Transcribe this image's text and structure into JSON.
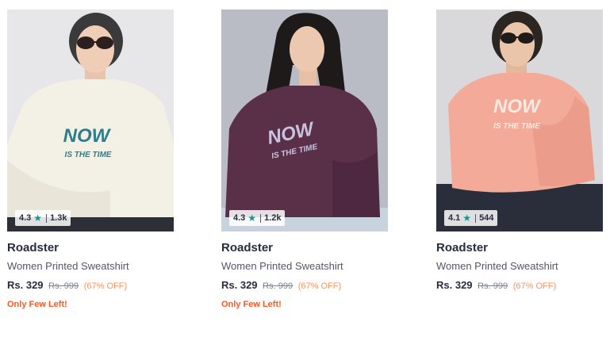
{
  "products": [
    {
      "brand": "Roadster",
      "name": "Women Printed Sweatshirt",
      "price": "Rs. 329",
      "mrp": "Rs. 999",
      "discount": "(67% OFF)",
      "rating": "4.3",
      "rating_count": "1.3k",
      "stock_note": "Only Few Left!",
      "print_line1": "NOW",
      "print_line2": "IS THE TIME",
      "sweatshirt_color": "#f3f0e6",
      "print_color": "#2f7d8a"
    },
    {
      "brand": "Roadster",
      "name": "Women Printed Sweatshirt",
      "price": "Rs. 329",
      "mrp": "Rs. 999",
      "discount": "(67% OFF)",
      "rating": "4.3",
      "rating_count": "1.2k",
      "stock_note": "Only Few Left!",
      "print_line1": "NOW",
      "print_line2": "IS THE TIME",
      "sweatshirt_color": "#5a3049",
      "print_color": "#c9c3e0"
    },
    {
      "brand": "Roadster",
      "name": "Women Printed Sweatshirt",
      "price": "Rs. 329",
      "mrp": "Rs. 999",
      "discount": "(67% OFF)",
      "rating": "4.1",
      "rating_count": "544",
      "stock_note": "",
      "print_line1": "NOW",
      "print_line2": "IS THE TIME",
      "sweatshirt_color": "#f4aa98",
      "print_color": "#fbe9e2"
    }
  ],
  "colors": {
    "star": "#14958f",
    "discount": "#ff905a",
    "stock_alert": "#ff5722",
    "text_primary": "#282c3f",
    "text_secondary": "#535766"
  },
  "icons": {
    "rating": "star-icon"
  }
}
